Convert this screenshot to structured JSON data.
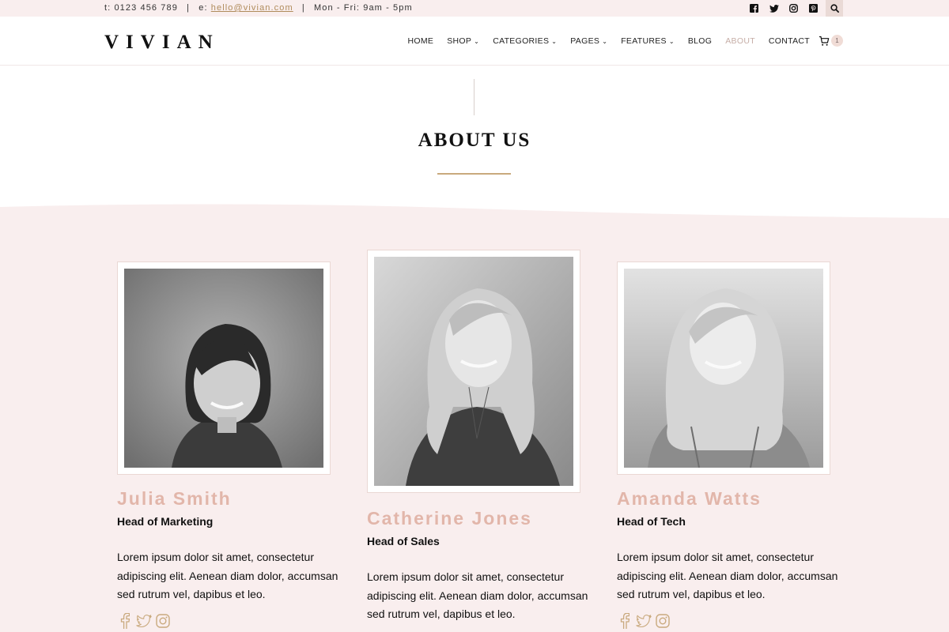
{
  "topbar": {
    "phone": "t: 0123 456 789",
    "email_prefix": "e:",
    "email": "hello@vivian.com",
    "hours": "Mon - Fri: 9am - 5pm",
    "social_icons": [
      "facebook-icon",
      "twitter-icon",
      "instagram-icon",
      "pinterest-icon"
    ],
    "search_icon": "search-icon"
  },
  "header": {
    "logo": "VIVIAN",
    "nav": [
      {
        "label": "HOME"
      },
      {
        "label": "SHOP"
      },
      {
        "label": "CATEGORIES"
      },
      {
        "label": "PAGES"
      },
      {
        "label": "FEATURES"
      },
      {
        "label": "BLOG"
      },
      {
        "label": "ABOUT"
      },
      {
        "label": "CONTACT"
      }
    ],
    "cart_count": "1"
  },
  "page": {
    "title": "ABOUT US"
  },
  "team": [
    {
      "name": "Julia Smith",
      "role": "Head of Marketing",
      "bio": "Lorem ipsum dolor sit amet, consectetur adipiscing elit. Aenean diam dolor, accumsan sed rutrum vel, dapibus et leo."
    },
    {
      "name": "Catherine Jones",
      "role": "Head of Sales",
      "bio": "Lorem ipsum dolor sit amet, consectetur adipiscing elit. Aenean diam dolor, accumsan sed rutrum vel, dapibus et leo."
    },
    {
      "name": "Amanda Watts",
      "role": "Head of Tech",
      "bio": "Lorem ipsum dolor sit amet, consectetur adipiscing elit. Aenean diam dolor, accumsan sed rutrum vel, dapibus et leo."
    }
  ],
  "colors": {
    "topbar_bg": "#f9eeee",
    "section_bg": "#f9eeee",
    "accent_gold": "#c9a97d",
    "name_pink": "#e2b6aa"
  }
}
